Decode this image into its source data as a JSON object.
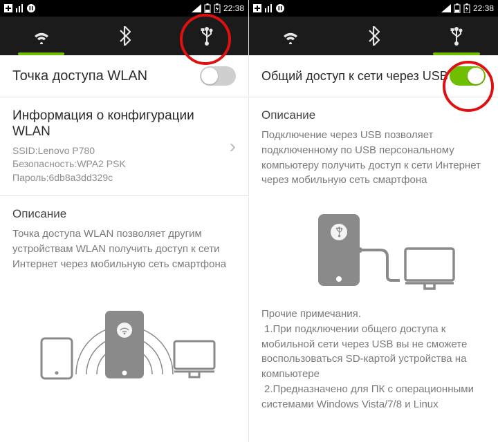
{
  "status": {
    "time": "22:38"
  },
  "left": {
    "tabs": {
      "active": 0
    },
    "toggle": {
      "label": "Точка доступа WLAN",
      "on": false
    },
    "config": {
      "title": "Информация о конфигурации WLAN",
      "ssid_label": "SSID:",
      "ssid": "Lenovo P780",
      "security_label": "Безопасность:",
      "security": "WPA2 PSK",
      "password_label": "Пароль:",
      "password": "6db8a3dd329c"
    },
    "desc": {
      "heading": "Описание",
      "text": "Точка доступа WLAN позволяет другим устройствам WLAN получить доступ к сети Интернет через мобильную сеть смартфона"
    }
  },
  "right": {
    "tabs": {
      "active": 2
    },
    "toggle": {
      "label": "Общий доступ к сети через USB",
      "on": true
    },
    "desc": {
      "heading": "Описание",
      "text": "Подключение через USB позволяет подключенному по USB персональному компьютеру получить доступ к сети Интернет через мобильную сеть смартфона"
    },
    "notes": {
      "heading": "Прочие примечания.",
      "item1": "1.При подключении общего доступа к мобильной сети через USB вы не сможете воспользоваться SD-картой устройства на компьютере",
      "item2": "2.Предназначено для ПК с операционными системами Windows Vista/7/8 и Linux"
    }
  }
}
